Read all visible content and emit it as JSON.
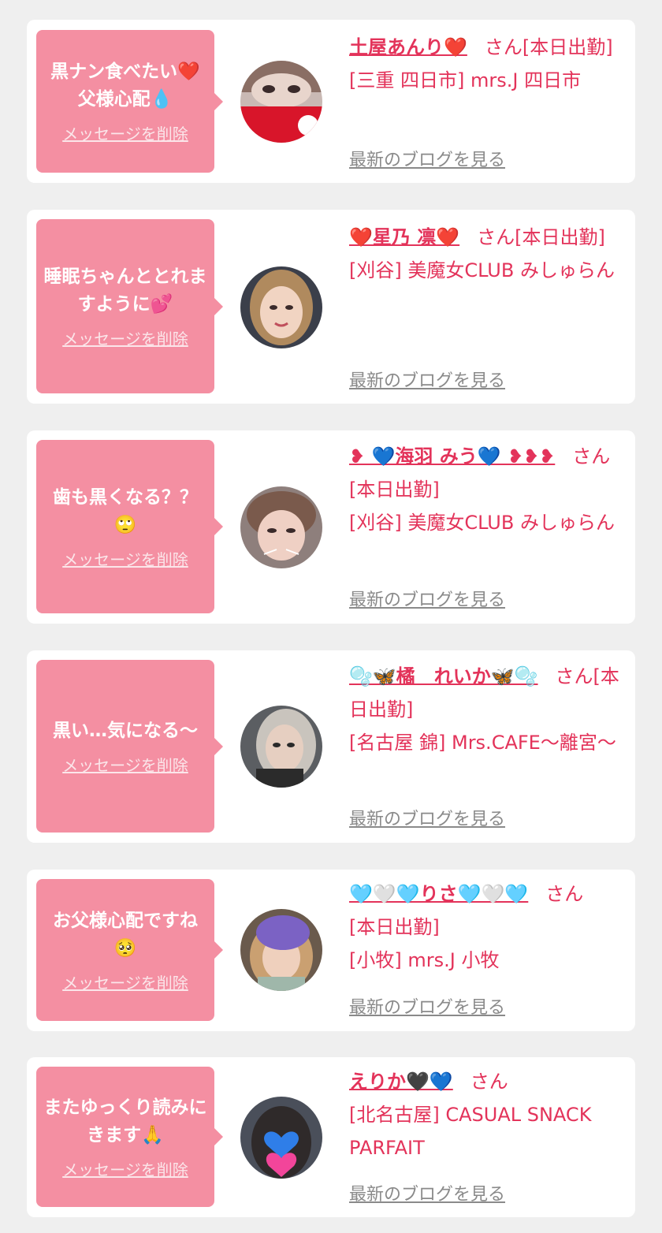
{
  "delete_label": "メッセージを削除",
  "blog_label": "最新のブログを見る",
  "san_suffix": "さん",
  "cards": [
    {
      "message": "黒ナン食べたい❤️\n父様心配💧",
      "name": "土屋あんり❤️",
      "status": "[本日出勤]",
      "shop": "[三重 四日市] mrs.J 四日市"
    },
    {
      "message": "睡眠ちゃんととれますように💕",
      "name": "❤️星乃 凛❤️",
      "status": "[本日出勤]",
      "shop": "[刈谷] 美魔女CLUB みしゅらん"
    },
    {
      "message": "歯も黒くなる？？🙄",
      "name": "❥ 💙海羽 みう💙 ❥❥❥",
      "status": "[本日出勤]",
      "shop": "[刈谷] 美魔女CLUB みしゅらん"
    },
    {
      "message": "黒い…気になる〜",
      "name": "🫧🦋橘　れいか🦋🫧",
      "status": "[本日出勤]",
      "shop": "[名古屋 錦] Mrs.CAFE〜離宮〜"
    },
    {
      "message": "お父様心配ですね🥺",
      "name": "🩵🤍🩵りさ🩵🤍🩵",
      "status": "[本日出勤]",
      "shop": "[小牧] mrs.J 小牧"
    },
    {
      "message": "またゆっくり読みにきます🙏",
      "name": "えりか🖤💙",
      "status": "",
      "shop": "[北名古屋] CASUAL SNACK PARFAIT"
    }
  ]
}
